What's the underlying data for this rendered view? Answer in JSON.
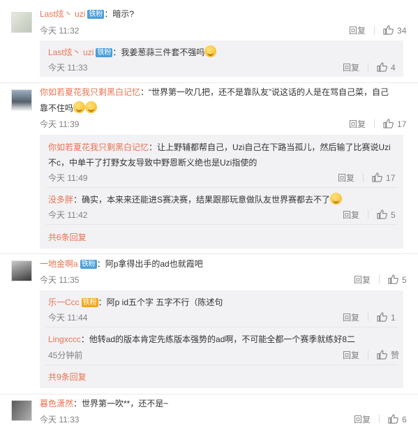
{
  "comments": [
    {
      "name": "Last炫丶 uzi",
      "badge": "铁粉",
      "text": "：暗示?",
      "time": "今天 11:32",
      "reply": "回复",
      "likes": "34",
      "replies": [
        {
          "name": "Last炫丶 uzi",
          "badge": "铁粉",
          "text": "：我姜葱蒜三件套不强吗",
          "time": "今天 11:33",
          "reply": "回复",
          "likes": "4"
        }
      ]
    },
    {
      "name": "你如若夏花我只剩黑白记忆",
      "text_line1": "：“世界第一吹几把，还不是靠队友”说这话的人是在骂自己菜，自己",
      "text_line2": "靠不住吗",
      "time": "今天 11:39",
      "reply": "回复",
      "likes": "17",
      "replies": [
        {
          "name": "你如若夏花我只剩黑白记忆",
          "text_line1": "：让上野辅都帮自己，Uzi自己在下路当孤儿，然后输了比赛说Uzi",
          "text_line2": "不c，中单干了打野女友导致中野恩断义绝也是Uzi指使的",
          "time": "今天 11:49",
          "reply": "回复",
          "likes": "17"
        },
        {
          "name": "没多胖",
          "text": "：确实，本来来还能进S赛决赛，结果跟那玩意做队友世界赛都去不了",
          "time": "今天 11:42",
          "reply": "回复",
          "likes": "5"
        }
      ],
      "more": "共6条回复"
    },
    {
      "name": "一地金啊a",
      "badge": "铁粉",
      "text": "：阿p拿得出手的ad也就霞吧",
      "time": "今天 11:35",
      "reply": "回复",
      "likes": "5",
      "replies": [
        {
          "name": "乐一Ccc",
          "badge": "铁粉",
          "text": "：阿p id五个字 五字不行（陈述句",
          "time": "今天 11:44",
          "reply": "回复",
          "likes": "1"
        },
        {
          "name": "Lingxccc",
          "text": "：他转ad的版本肯定先练版本强势的ad啊，不可能全都一个赛季就练好8二",
          "time": "45分钟前",
          "reply": "回复",
          "likes": "赞"
        }
      ],
      "more": "共9条回复"
    },
    {
      "name": "暮色潇然",
      "text": "：世界第一吹**，还不是~",
      "time": "今天 11:33",
      "reply": "回复",
      "likes": "6"
    }
  ],
  "icons": {
    "like": "thumbs-up-icon",
    "emoji": "smile-emoji-icon"
  },
  "colors": {
    "username": "#eb7350",
    "reply_bg": "#f2f2f5",
    "badge": "#4b9fd8"
  }
}
